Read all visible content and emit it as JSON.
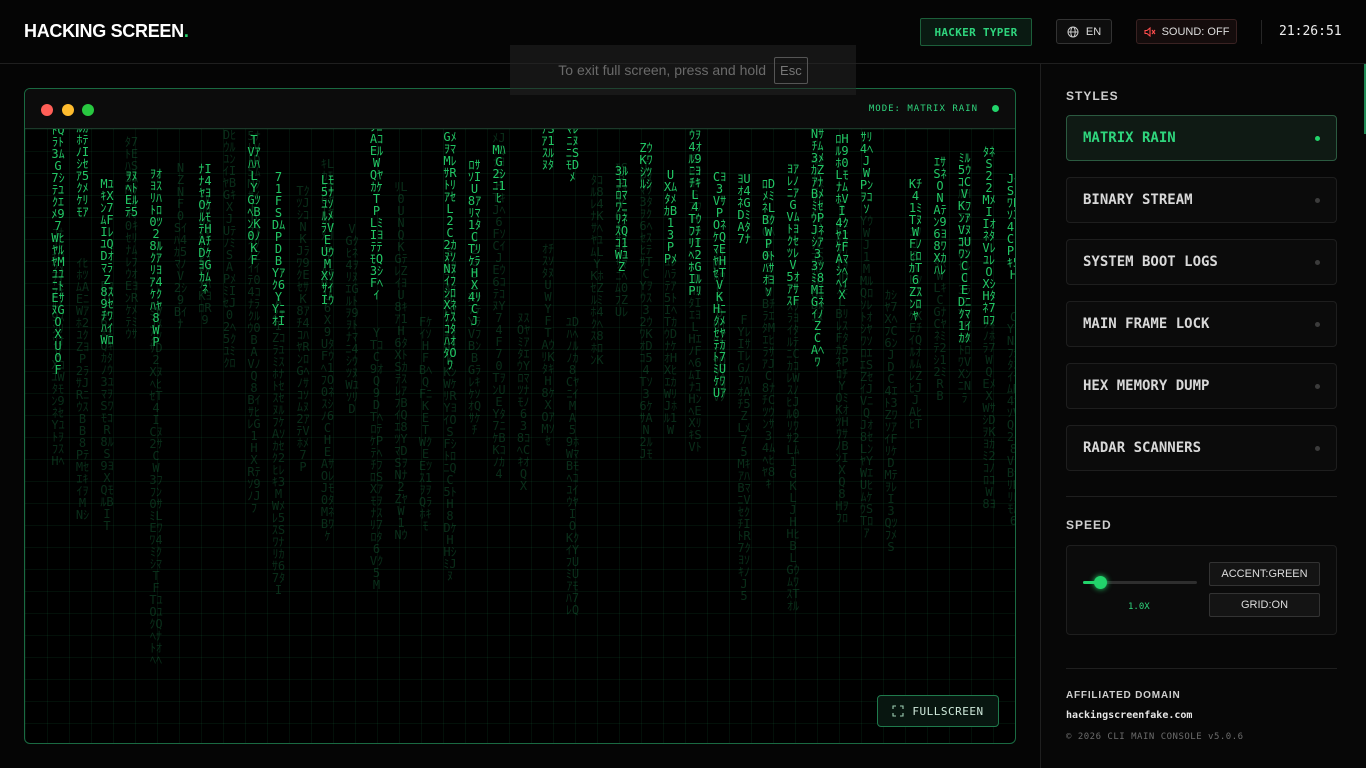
{
  "header": {
    "logo_text": "HACKING SCREEN",
    "logo_dot": ".",
    "hacker_typer_label": "HACKER TYPER",
    "language_label": "EN",
    "sound_label": "SOUND: OFF",
    "clock": "21:26:51"
  },
  "toast": {
    "message": "To exit full screen, press and hold",
    "key": "Esc"
  },
  "terminal": {
    "mode_label": "MODE: MATRIX RAIN",
    "fullscreen_label": "FULLSCREEN"
  },
  "sidebar": {
    "styles_title": "STYLES",
    "styles": [
      {
        "label": "MATRIX RAIN",
        "active": true
      },
      {
        "label": "BINARY STREAM",
        "active": false
      },
      {
        "label": "SYSTEM BOOT LOGS",
        "active": false
      },
      {
        "label": "MAIN FRAME LOCK",
        "active": false
      },
      {
        "label": "HEX MEMORY DUMP",
        "active": false
      },
      {
        "label": "RADAR SCANNERS",
        "active": false
      }
    ],
    "speed_title": "SPEED",
    "speed_value": "1.0X",
    "speed_level": 0.15,
    "accent_button": "ACCENT:GREEN",
    "grid_button": "GRID:ON",
    "affiliated_title": "AFFILIATED DOMAIN",
    "affiliated_domain": "hackingscreenfake.com",
    "copyright": "© 2026 CLI MAIN CONSOLE v5.0.6"
  },
  "colors": {
    "accent": "#22d46b",
    "accent_text": "#2fd57d",
    "background": "#050505",
    "border_accent": "#1a6a42"
  },
  "icons": {
    "language": "globe-icon",
    "sound": "speaker-muted-icon",
    "fullscreen": "expand-icon"
  }
}
